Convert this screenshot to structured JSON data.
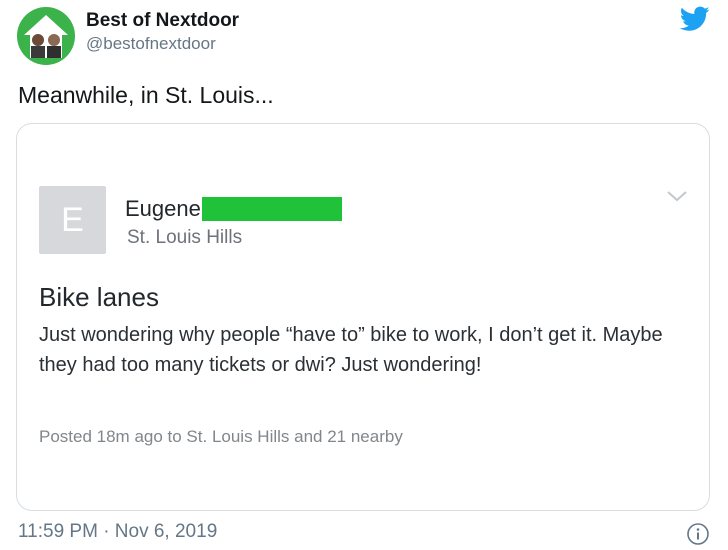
{
  "tweet": {
    "author_name": "Best of Nextdoor",
    "author_handle": "@bestofnextdoor",
    "text": "Meanwhile, in St. Louis...",
    "timestamp": "11:59 PM · Nov 6, 2019"
  },
  "nextdoor_post": {
    "avatar_initial": "E",
    "author_first_name": "Eugene",
    "neighborhood": "St. Louis Hills",
    "title": "Bike lanes",
    "body": "Just wondering why people “have to” bike to work, I don’t get it.  Maybe they had too many tickets or dwi? Just wondering!",
    "meta": "Posted 18m ago to St. Louis Hills and 21 nearby"
  },
  "icons": {
    "brand": "twitter-bird-icon",
    "menu": "chevron-down-icon",
    "info": "info-icon"
  },
  "colors": {
    "twitter_blue": "#1da1f2",
    "redaction_green": "#1fc238",
    "nextdoor_green": "#3bb34a"
  }
}
